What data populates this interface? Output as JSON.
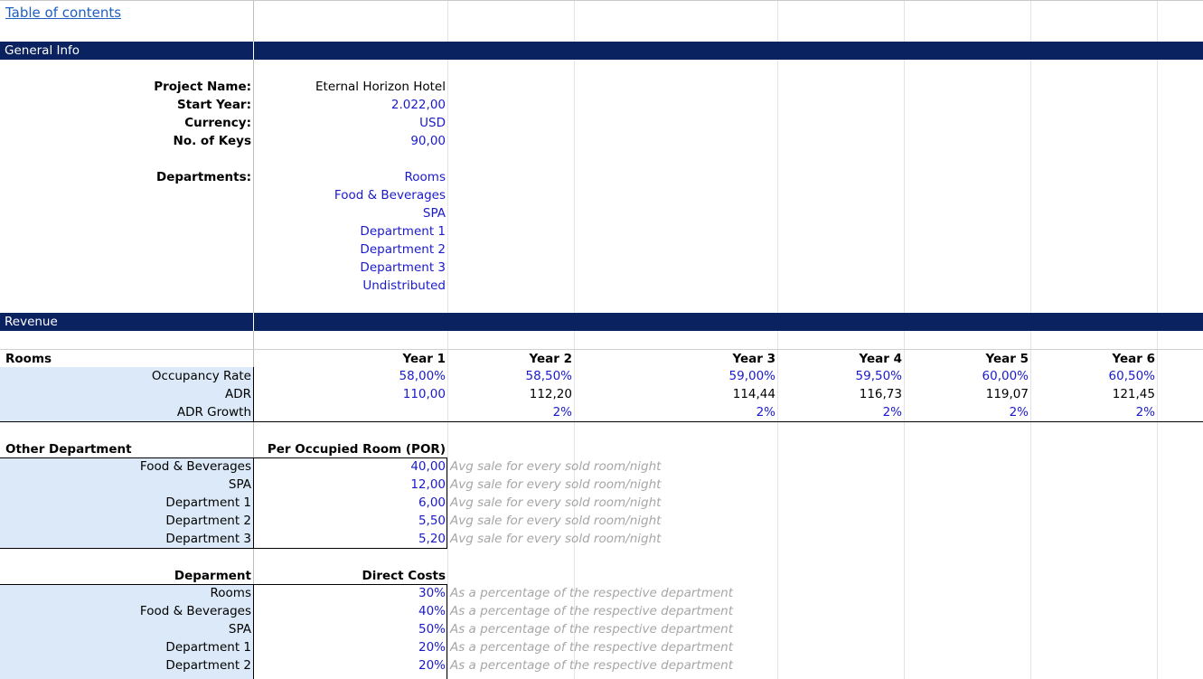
{
  "toc_link": "Table of contents",
  "sections": {
    "general": "General Info",
    "revenue": "Revenue"
  },
  "general": {
    "project_label": "Project Name:",
    "project_value": "Eternal Horizon Hotel",
    "start_label": "Start Year:",
    "start_value": "2.022,00",
    "currency_label": "Currency:",
    "currency_value": "USD",
    "keys_label": "No. of Keys",
    "keys_value": "90,00",
    "departments_label": "Departments:",
    "departments": [
      "Rooms",
      "Food & Beverages",
      "SPA",
      "Department 1",
      "Department 2",
      "Department 3",
      "Undistributed"
    ]
  },
  "rooms": {
    "header": "Rooms",
    "years": [
      "Year 1",
      "Year 2",
      "Year 3",
      "Year 4",
      "Year 5",
      "Year 6"
    ],
    "occupancy_label": "Occupancy Rate",
    "occupancy": [
      "58,00%",
      "58,50%",
      "59,00%",
      "59,50%",
      "60,00%",
      "60,50%"
    ],
    "adr_label": "ADR",
    "adr": [
      "110,00",
      "112,20",
      "114,44",
      "116,73",
      "119,07",
      "121,45"
    ],
    "growth_label": "ADR Growth",
    "growth": [
      "",
      "2%",
      "2%",
      "2%",
      "2%",
      "2%"
    ]
  },
  "other": {
    "header": "Other Department",
    "por_header": "Per Occupied Room (POR)",
    "items": [
      {
        "label": "Food & Beverages",
        "value": "40,00",
        "note": "Avg sale for every sold room/night"
      },
      {
        "label": "SPA",
        "value": "12,00",
        "note": "Avg sale for every sold room/night"
      },
      {
        "label": "Department 1",
        "value": "6,00",
        "note": "Avg sale for every sold room/night"
      },
      {
        "label": "Department 2",
        "value": "5,50",
        "note": "Avg sale for every sold room/night"
      },
      {
        "label": "Department 3",
        "value": "5,20",
        "note": "Avg sale for every sold room/night"
      }
    ]
  },
  "direct": {
    "header": "Deparment",
    "costs_header": "Direct Costs",
    "items": [
      {
        "label": "Rooms",
        "value": "30%",
        "note": "As a percentage of the respective department"
      },
      {
        "label": "Food & Beverages",
        "value": "40%",
        "note": "As a percentage of the respective department"
      },
      {
        "label": "SPA",
        "value": "50%",
        "note": "As a percentage of the respective department"
      },
      {
        "label": "Department 1",
        "value": "20%",
        "note": "As a percentage of the respective department"
      },
      {
        "label": "Department 2",
        "value": "20%",
        "note": "As a percentage of the respective department"
      }
    ]
  }
}
